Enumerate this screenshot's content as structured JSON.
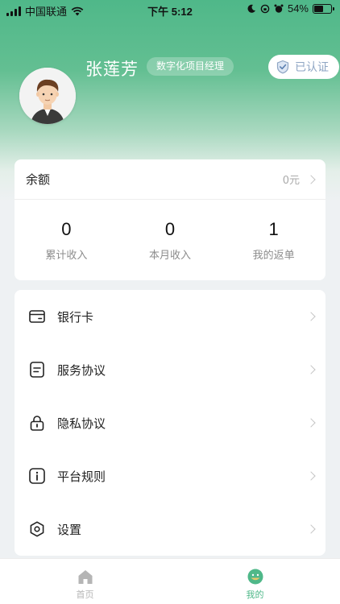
{
  "status_bar": {
    "carrier": "中国联通",
    "time": "下午 5:12",
    "battery": "54%",
    "battery_level": 0.54
  },
  "profile": {
    "name": "张莲芳",
    "role": "数字化项目经理",
    "verified_label": "已认证",
    "avatar_icon": "avatar-man-icon"
  },
  "balance": {
    "label": "余额",
    "value": "0元"
  },
  "stats": [
    {
      "value": "0",
      "label": "累计收入"
    },
    {
      "value": "0",
      "label": "本月收入"
    },
    {
      "value": "1",
      "label": "我的返单"
    }
  ],
  "menu": [
    {
      "label": "银行卡",
      "icon": "bank-card-icon"
    },
    {
      "label": "服务协议",
      "icon": "document-icon"
    },
    {
      "label": "隐私协议",
      "icon": "lock-icon"
    },
    {
      "label": "平台规则",
      "icon": "info-icon"
    },
    {
      "label": "设置",
      "icon": "settings-hexagon-icon"
    }
  ],
  "tabs": [
    {
      "label": "首页",
      "icon": "home-icon",
      "active": false
    },
    {
      "label": "我的",
      "icon": "profile-icon",
      "active": true
    }
  ],
  "colors": {
    "brand_green": "#4fb889",
    "tab_active": "#4fb889",
    "tab_inactive": "#b5b5b5",
    "verified_text": "#8fa6c4"
  }
}
